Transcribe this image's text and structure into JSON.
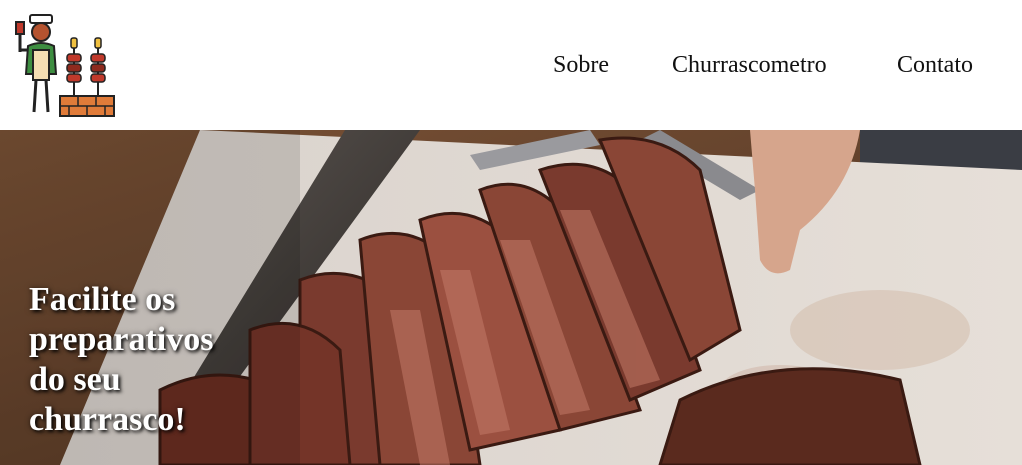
{
  "header": {
    "logo_icon": "barbecue-chef-logo-icon",
    "nav": {
      "sobre": "Sobre",
      "churrascometro": "Churrascometro",
      "contato": "Contato"
    }
  },
  "hero": {
    "image": "sliced-steak-photo",
    "title": "Facilite os preparativos do seu churrasco!"
  },
  "colors": {
    "header_bg": "#ffffff",
    "nav_text": "#111111",
    "hero_title": "#ffffff"
  }
}
